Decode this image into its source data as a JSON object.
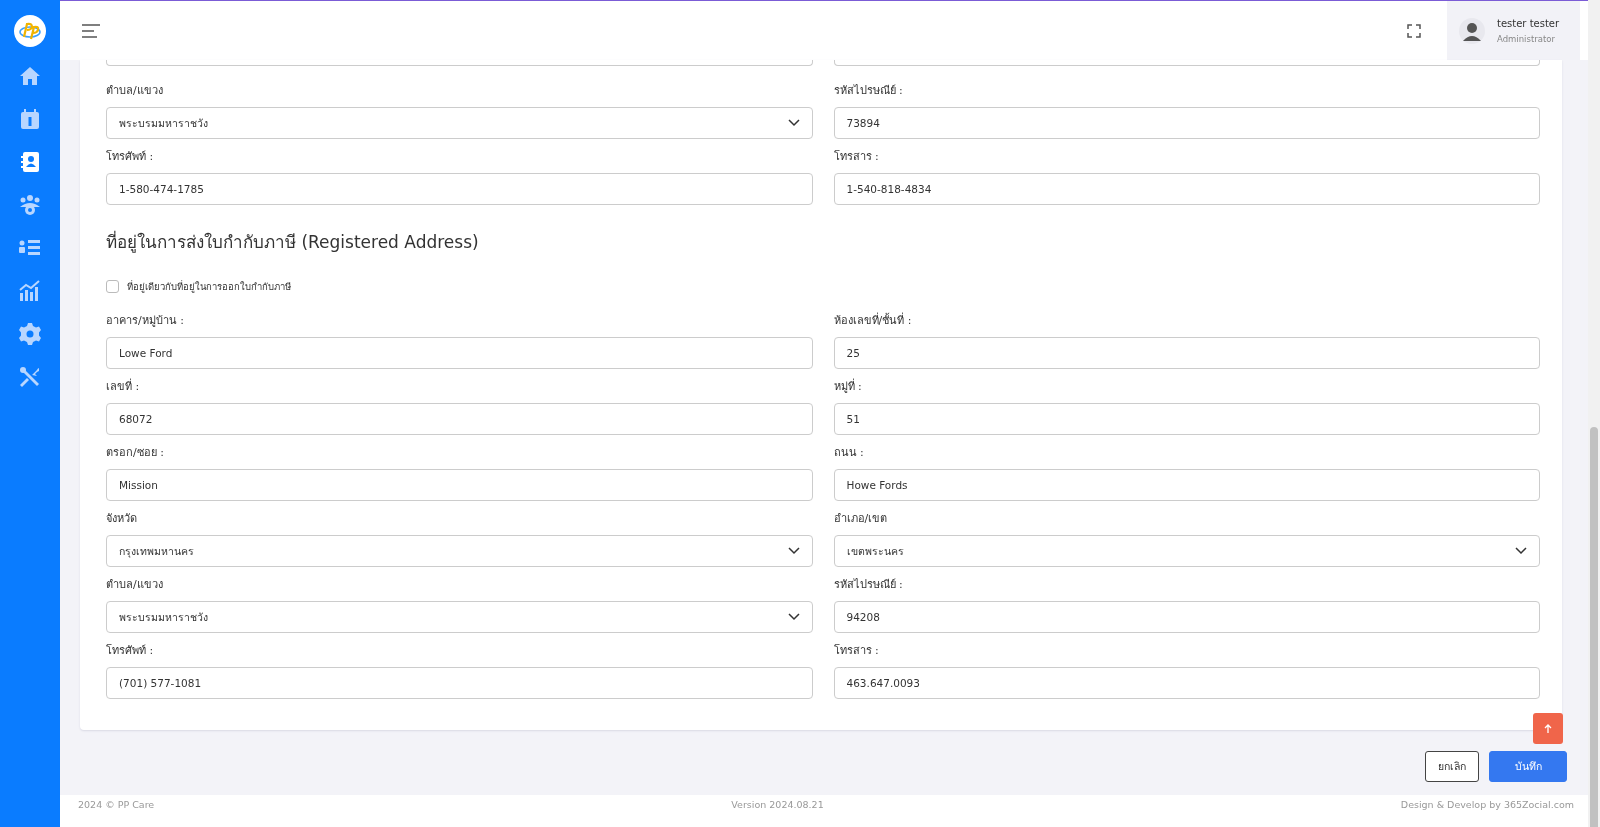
{
  "sidebar": {
    "items": [
      {
        "kind": "home",
        "selected": false
      },
      {
        "kind": "billing",
        "selected": false
      },
      {
        "kind": "contacts",
        "selected": true
      },
      {
        "kind": "team",
        "selected": false
      },
      {
        "kind": "list",
        "selected": false
      },
      {
        "kind": "chart",
        "selected": false
      },
      {
        "kind": "settings",
        "selected": false
      },
      {
        "kind": "tools",
        "selected": false
      }
    ]
  },
  "topbar": {
    "user": {
      "name": "tester tester",
      "role": "Administrator"
    }
  },
  "sections": [
    {
      "cut_fields": [
        {
          "kind": "text"
        },
        {
          "kind": "text"
        }
      ],
      "fields": [
        {
          "label": "ตำบล/แขวง",
          "value": "พระบรมมหาราชวัง",
          "kind": "select"
        },
        {
          "label": "รหัสไปรษณีย์ :",
          "value": "73894",
          "kind": "text"
        },
        {
          "label": "โทรศัพท์ :",
          "value": "1-580-474-1785",
          "kind": "text"
        },
        {
          "label": "โทรสาร :",
          "value": "1-540-818-4834",
          "kind": "text"
        }
      ]
    },
    {
      "title": "ที่อยู่ในการส่งใบกำกับภาษี (Registered Address)",
      "checkbox": {
        "label": "ที่อยู่เดียวกับที่อยู่ในการออกใบกำกับภาษี",
        "checked": false
      },
      "fields": [
        {
          "label": "อาคาร/หมู่บ้าน :",
          "value": "Lowe Ford",
          "kind": "text"
        },
        {
          "label": "ห้องเลขที่/ชั้นที่ :",
          "value": "25",
          "kind": "text"
        },
        {
          "label": "เลขที่ :",
          "value": "68072",
          "kind": "text"
        },
        {
          "label": "หมู่ที่ :",
          "value": "51",
          "kind": "text"
        },
        {
          "label": "ตรอก/ซอย :",
          "value": "Mission",
          "kind": "text"
        },
        {
          "label": "ถนน :",
          "value": "Howe Fords",
          "kind": "text"
        },
        {
          "label": "จังหวัด",
          "value": "กรุงเทพมหานคร",
          "kind": "select"
        },
        {
          "label": "อำเภอ/เขต",
          "value": "เขตพระนคร",
          "kind": "select"
        },
        {
          "label": "ตำบล/แขวง",
          "value": "พระบรมมหาราชวัง",
          "kind": "select"
        },
        {
          "label": "รหัสไปรษณีย์ :",
          "value": "94208",
          "kind": "text"
        },
        {
          "label": "โทรศัพท์ :",
          "value": "(701) 577-1081",
          "kind": "text"
        },
        {
          "label": "โทรสาร :",
          "value": "463.647.0093",
          "kind": "text"
        }
      ]
    }
  ],
  "actions": [
    {
      "label": "ยกเลิก",
      "kind": "secondary"
    },
    {
      "label": "บันทึก",
      "kind": "primary"
    }
  ],
  "footer": {
    "copyright": "2024 © PP Care",
    "version": "Version 2024.08.21",
    "credit": "Design & Develop by 365Zocial.com"
  }
}
